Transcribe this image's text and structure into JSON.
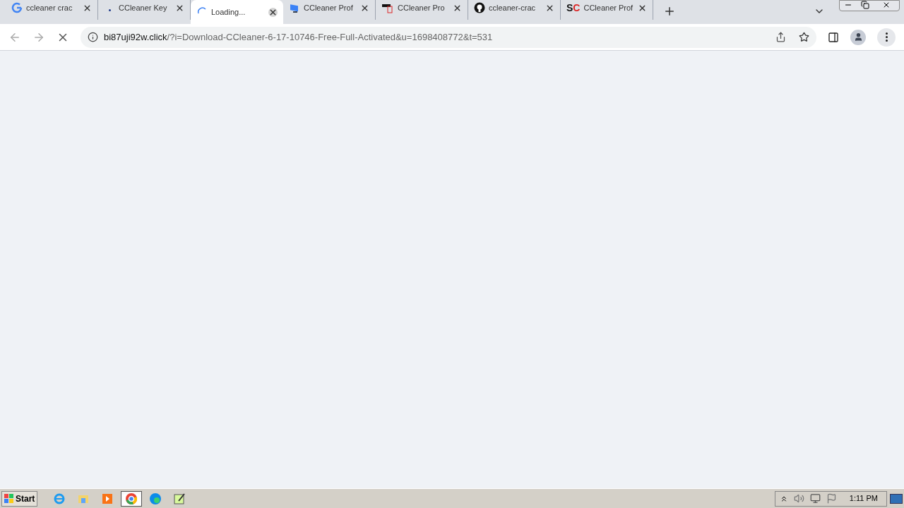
{
  "tabs": [
    {
      "title": "ccleaner crac",
      "kind": "google",
      "selected": false
    },
    {
      "title": "CCleaner Key",
      "kind": "dot",
      "selected": false
    },
    {
      "title": "Loading...",
      "kind": "spinner",
      "selected": true
    },
    {
      "title": "CCleaner Prof",
      "kind": "monitor",
      "selected": false
    },
    {
      "title": "CCleaner Pro",
      "kind": "doc",
      "selected": false
    },
    {
      "title": "ccleaner-crac",
      "kind": "github",
      "selected": false
    },
    {
      "title": "CCleaner Prof",
      "kind": "sc",
      "sc_text": "SC",
      "selected": false
    }
  ],
  "address_bar": {
    "host": "bi87uji92w.click",
    "path": "/?i=Download-CCleaner-6-17-10746-Free-Full-Activated&u=1698408772&t=531"
  },
  "taskbar": {
    "start_label": "Start",
    "apps": [
      {
        "kind": "ie",
        "selected": false
      },
      {
        "kind": "folder",
        "selected": false
      },
      {
        "kind": "media",
        "selected": false
      },
      {
        "kind": "chrome",
        "selected": true
      },
      {
        "kind": "edge",
        "selected": false
      },
      {
        "kind": "notepad",
        "selected": false
      }
    ],
    "clock": "1:11 PM"
  }
}
